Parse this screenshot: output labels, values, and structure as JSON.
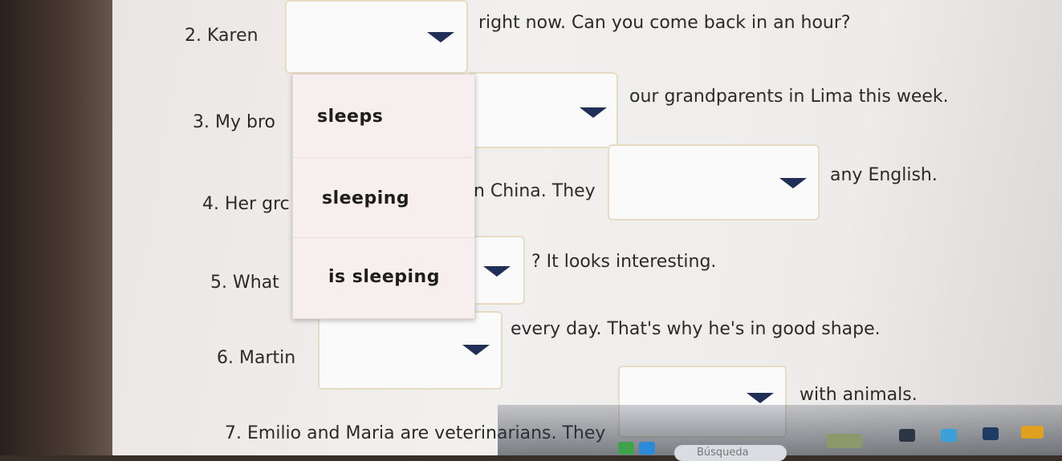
{
  "questions": {
    "q2": {
      "number": "2.",
      "before": "Karen",
      "after": "right now. Can you come back in an hour?"
    },
    "q3": {
      "number": "3.",
      "before": "My bro",
      "after": "our grandparents in Lima this week."
    },
    "q4": {
      "number": "4.",
      "before": "Her grc",
      "middle": "n China. They",
      "after": "any English."
    },
    "q5": {
      "number": "5.",
      "before": "What",
      "after": "? It looks interesting."
    },
    "q6": {
      "number": "6.",
      "before": "Martin",
      "after": "every day. That's why he's in good shape."
    },
    "q7": {
      "number": "7.",
      "before": "Emilio and Maria are veterinarians. They",
      "after": "with animals."
    }
  },
  "dropdown_menu": {
    "options": [
      "sleeps",
      "sleeping",
      "is sleeping"
    ]
  },
  "taskbar": {
    "search_placeholder": "Búsqueda"
  },
  "colors": {
    "dropdown_arrow": "#1f2f55",
    "menu_background": "#f7efef",
    "dropdown_border": "#e6dcc4"
  }
}
